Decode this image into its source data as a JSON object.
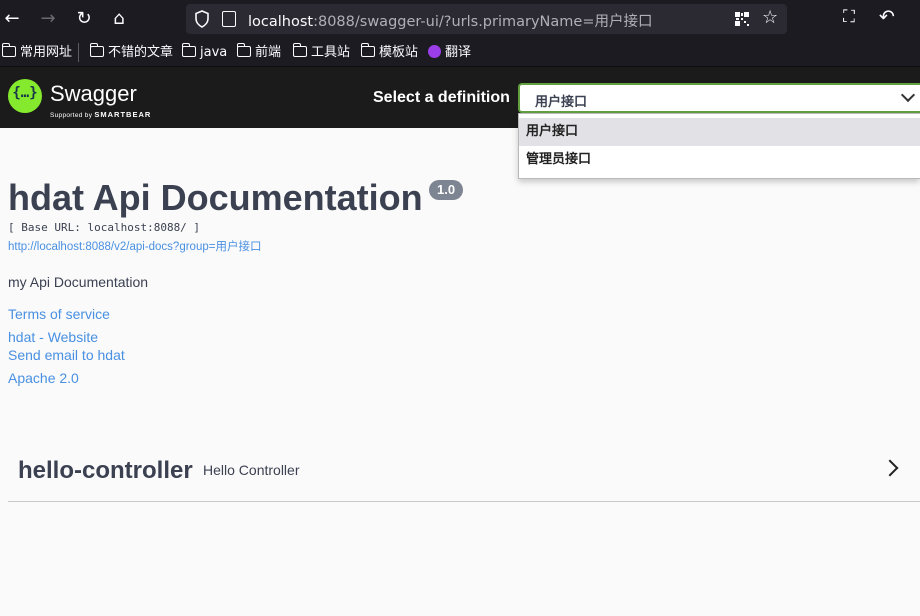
{
  "browser": {
    "url_host": "localhost",
    "url_rest": ":8088/swagger-ui/?urls.primaryName=用户接口"
  },
  "bookmarks": [
    "常用网址",
    "不错的文章",
    "java",
    "前端",
    "工具站",
    "模板站",
    "翻译"
  ],
  "topbar": {
    "logo_text": "Swagger",
    "logo_sub_prefix": "Supported by",
    "logo_sub_brand": "SMARTBEAR",
    "select_label": "Select a definition",
    "selected_definition": "用户接口",
    "options": [
      "用户接口",
      "管理员接口"
    ]
  },
  "info": {
    "title": "hdat Api Documentation",
    "version": "1.0",
    "base_url": "[ Base URL: localhost:8088/ ]",
    "api_docs_url": "http://localhost:8088/v2/api-docs?group=用户接口",
    "description": "my Api Documentation",
    "terms": "Terms of service",
    "website": "hdat - Website",
    "email": "Send email to hdat",
    "license": "Apache 2.0"
  },
  "controllers": [
    {
      "name": "hello-controller",
      "description": "Hello Controller"
    }
  ],
  "colors": {
    "accent": "#85ea2d",
    "link": "#4990e2",
    "text": "#3b4151",
    "select_border": "#62a03f"
  }
}
